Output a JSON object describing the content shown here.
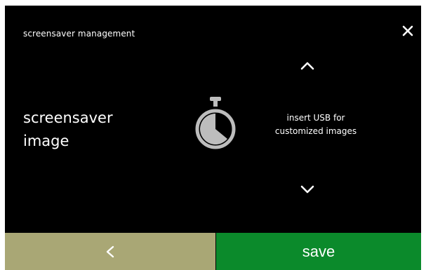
{
  "header": {
    "title": "screensaver management",
    "close_icon": "close-icon"
  },
  "setting": {
    "label_line1": "screensaver",
    "label_line2": "image"
  },
  "navigation": {
    "up_icon": "chevron-up-icon",
    "down_icon": "chevron-down-icon"
  },
  "option": {
    "icon": "timer-icon",
    "text_line1": "insert USB for",
    "text_line2": "customized images"
  },
  "footer": {
    "back_icon": "chevron-left-icon",
    "save_label": "save"
  },
  "colors": {
    "background": "#000000",
    "back_button": "#a9a775",
    "save_button": "#0b8a2b",
    "icon_gray": "#bdbdbd"
  }
}
